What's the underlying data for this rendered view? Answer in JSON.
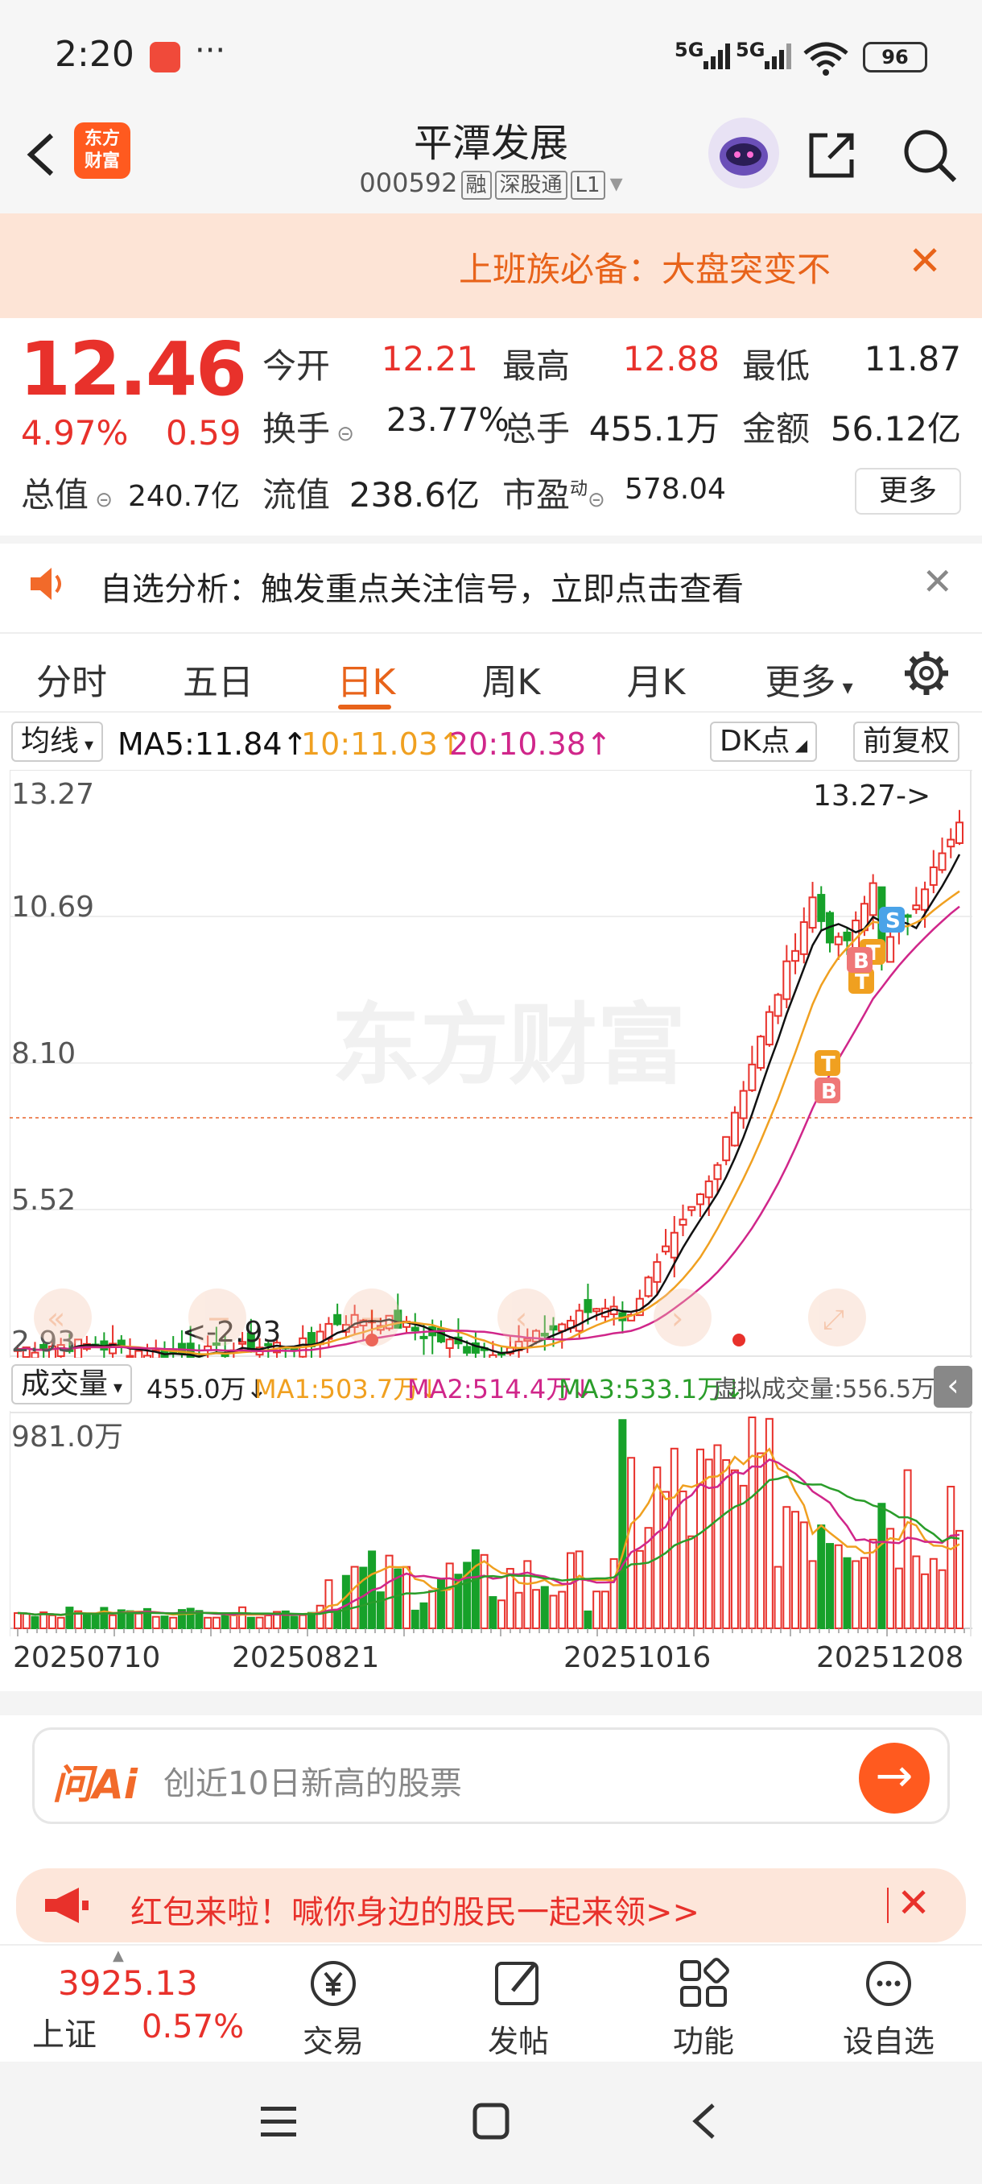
{
  "status_bar": {
    "time": "2:20",
    "dots": "···",
    "net1": "5G",
    "net2": "5G",
    "battery": "96"
  },
  "header": {
    "logo_line1": "东方",
    "logo_line2": "财富",
    "stock_name": "平潭发展",
    "stock_code": "000592",
    "tags": [
      "融",
      "深股通",
      "L1"
    ]
  },
  "banner_top": {
    "text": "上班族必备：大盘突变不",
    "close": "✕"
  },
  "quote": {
    "price": "12.46",
    "pct": "4.97%",
    "change": "0.59",
    "open_label": "今开",
    "open": "12.21",
    "high_label": "最高",
    "high": "12.88",
    "low_label": "最低",
    "low": "11.87",
    "turnover_label": "换手",
    "turnover": "23.77%",
    "volume_label": "总手",
    "volume": "455.1万",
    "amount_label": "金额",
    "amount": "56.12亿",
    "mktcap_label": "总值",
    "mktcap": "240.7亿",
    "float_label": "流值",
    "float": "238.6亿",
    "pe_label": "市盈",
    "pe_sup": "动",
    "pe": "578.04",
    "more": "更多"
  },
  "banner_analysis": {
    "text": "自选分析：触发重点关注信号，立即点击查看",
    "close": "✕"
  },
  "tabs": [
    "分时",
    "五日",
    "日K",
    "周K",
    "月K",
    "更多"
  ],
  "active_tab": "日K",
  "ma_bar": {
    "dropdown": "均线",
    "ma5": "MA5:11.84↑",
    "ma10": "10:11.03↑",
    "ma20": "20:10.38↑",
    "dk": "DK点",
    "adjust": "前复权",
    "colors": {
      "ma5": "#111111",
      "ma10": "#f0a020",
      "ma20": "#d0268a"
    }
  },
  "kline": {
    "y_ticks": [
      "13.27",
      "10.69",
      "8.10",
      "5.52",
      "2.93"
    ],
    "max_label": "13.27->",
    "min_label": "<-2.93",
    "watermark": "东方财富",
    "markers": [
      "B",
      "B",
      "B",
      "T",
      "T",
      "S"
    ]
  },
  "volume_bar": {
    "dropdown": "成交量",
    "vol": "455.0万↓",
    "ma1": "MA1:503.7万↓",
    "ma2": "MA2:514.4万↓",
    "ma3": "MA3:533.1万↓",
    "virtual": "虚拟成交量:556.5万",
    "max_label": "981.0万",
    "colors": {
      "ma1": "#f0a020",
      "ma2": "#d0268a",
      "ma3": "#2a9d2a"
    }
  },
  "dates": [
    "20250710",
    "20250821",
    "20251016",
    "20251208"
  ],
  "ask_ai": {
    "logo": "问Ai",
    "placeholder": "创近10日新高的股票",
    "go": "→"
  },
  "red_packet": {
    "text": "红包来啦！喊你身边的股民一起来领>>",
    "close": "✕"
  },
  "bottom_bar": {
    "index_value": "3925.13",
    "index_name": "上证",
    "index_pct": "0.57%",
    "items": [
      "交易",
      "发帖",
      "功能",
      "设自选"
    ]
  }
}
